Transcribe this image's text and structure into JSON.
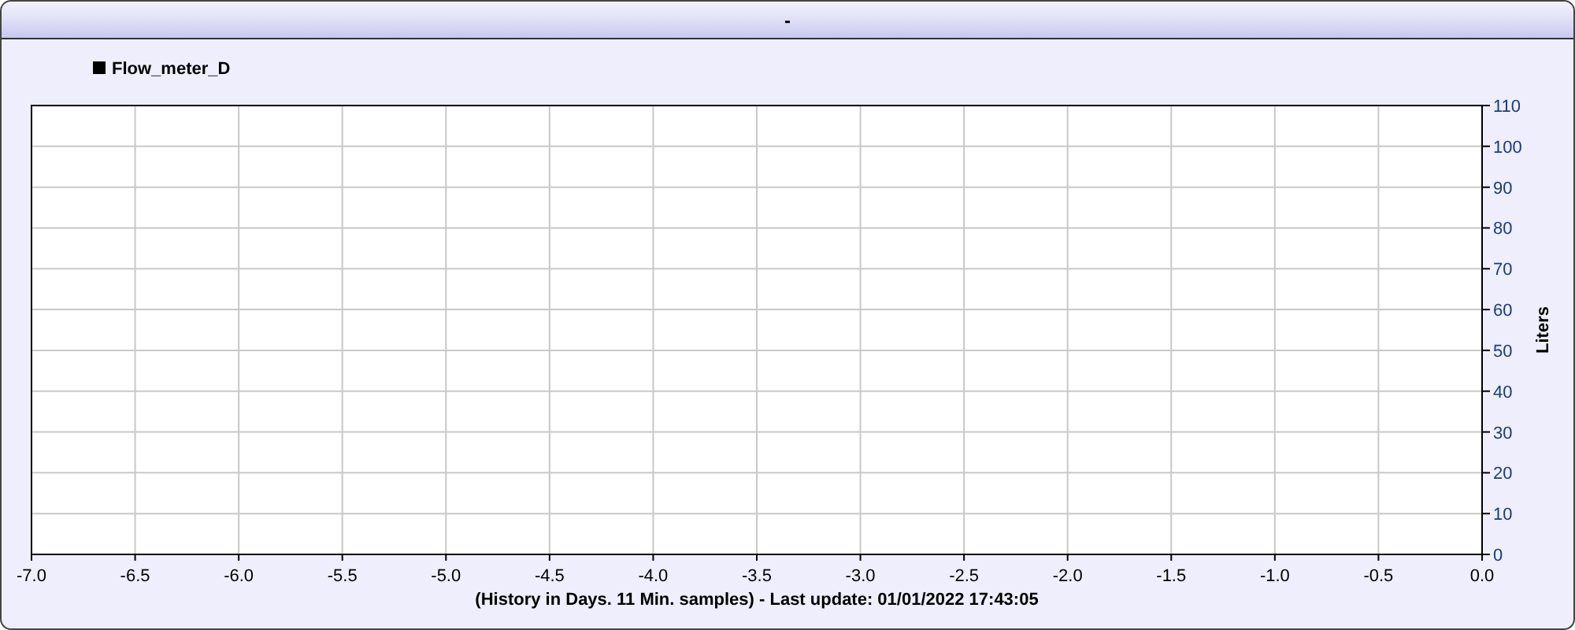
{
  "window": {
    "title": "-"
  },
  "chart_data": {
    "type": "line",
    "xlabel": "(History in Days. 11 Min. samples) - Last update: 01/01/2022 17:43:05",
    "ylabel": "Liters",
    "series": [
      {
        "name": "Flow_meter_D",
        "color": "#000000",
        "values": [
          null,
          null,
          null,
          null,
          null,
          null,
          null,
          null,
          null,
          null,
          null,
          null,
          null,
          null,
          null
        ]
      }
    ],
    "grid": true,
    "categories": [
      "-7.0",
      "-6.5",
      "-6.0",
      "-5.5",
      "-5.0",
      "-4.5",
      "-4.0",
      "-3.5",
      "-3.0",
      "-2.5",
      "-2.0",
      "-1.5",
      "-1.0",
      "-0.5",
      "0.0"
    ],
    "ylim": [
      0,
      110
    ],
    "yticks": [
      0,
      10,
      20,
      30,
      40,
      50,
      60,
      70,
      80,
      90,
      100,
      110
    ]
  }
}
